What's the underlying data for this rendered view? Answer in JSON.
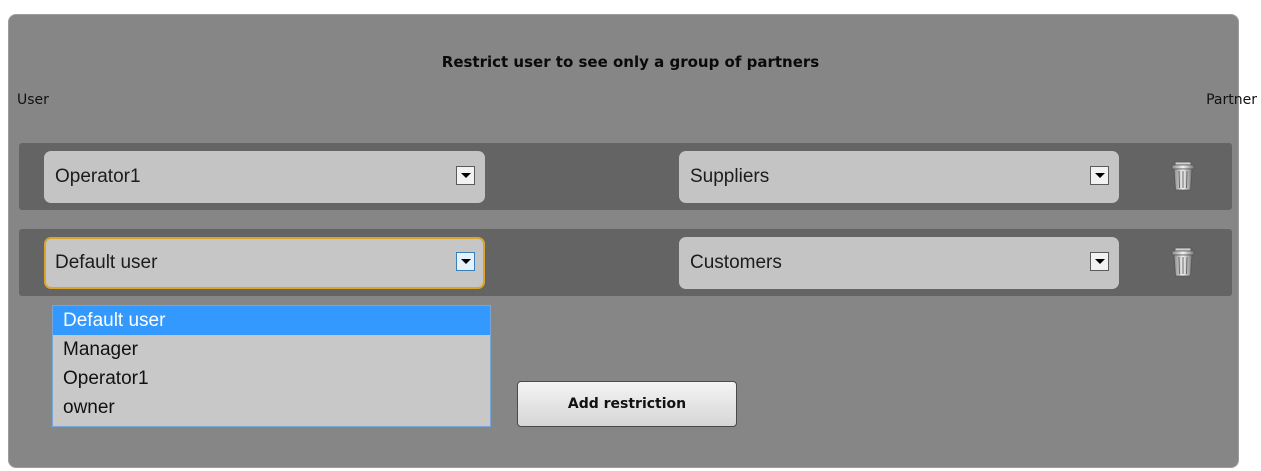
{
  "section": {
    "title": "Restrict user to see only a group of partners",
    "user_label": "User",
    "partner_label": "Partner"
  },
  "restrictions": [
    {
      "user": "Operator1",
      "partner": "Suppliers"
    },
    {
      "user": "Default user",
      "partner": "Customers"
    }
  ],
  "user_dropdown": {
    "options": [
      "Default user",
      "Manager",
      "Operator1",
      "owner"
    ],
    "selected": "Default user"
  },
  "actions": {
    "add_label": "Add restriction"
  },
  "icons": {
    "dropdown_arrow": "chevron-down-icon",
    "delete": "trash-icon"
  },
  "colors": {
    "panel": "#868686",
    "row": "#646464",
    "focus_border": "#d9a530",
    "selected_option": "#3399ff"
  }
}
